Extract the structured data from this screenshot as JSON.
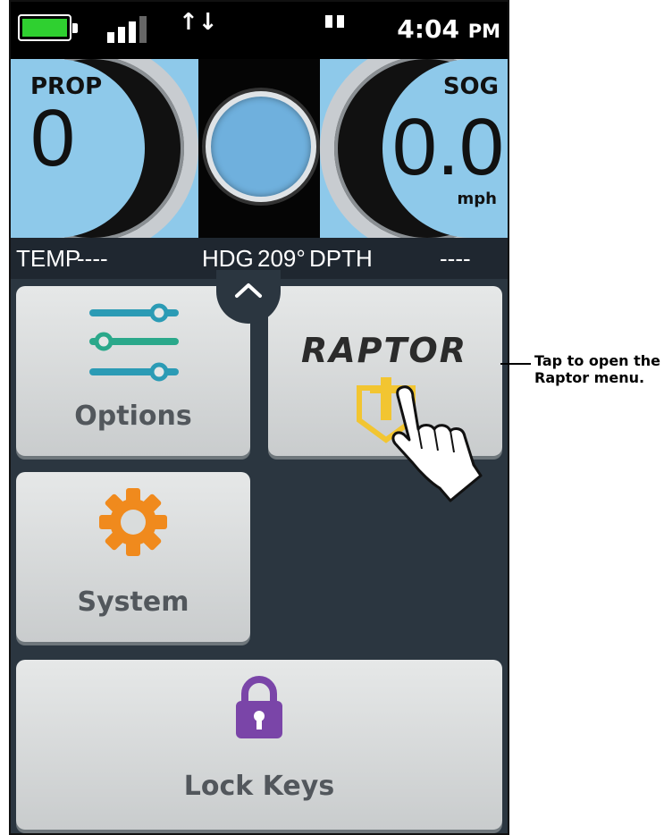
{
  "status_bar": {
    "time": "4:04",
    "time_suffix": "PM",
    "battery_color": "#2fd030",
    "icons": [
      "battery-icon",
      "signal-strength-icon",
      "data-transfer-icon",
      "sim-icon"
    ]
  },
  "gauges": {
    "prop_label": "PROP",
    "prop_value": "0",
    "sog_label": "SOG",
    "sog_value": "0.0",
    "sog_unit": "mph",
    "gauge_color": "#8ec9ea"
  },
  "info_bar": {
    "temp_label": "TEMP",
    "temp_value": "----",
    "hdg_label": "HDG",
    "hdg_value": "209°",
    "depth_label": "DPTH",
    "depth_value": "----"
  },
  "tiles": {
    "options_label": "Options",
    "raptor_label": "RAPTOR",
    "system_label": "System",
    "lock_keys_label": "Lock Keys"
  },
  "callout": {
    "line1": "Tap to open the",
    "line2": "Raptor menu."
  },
  "colors": {
    "options_icon": "#2b9bb5",
    "options_icon_alt": "#2aa88a",
    "system_icon": "#f08a1d",
    "lock_icon": "#7a45a8",
    "raptor_icon": "#f2c531",
    "background": "#2b3640"
  }
}
